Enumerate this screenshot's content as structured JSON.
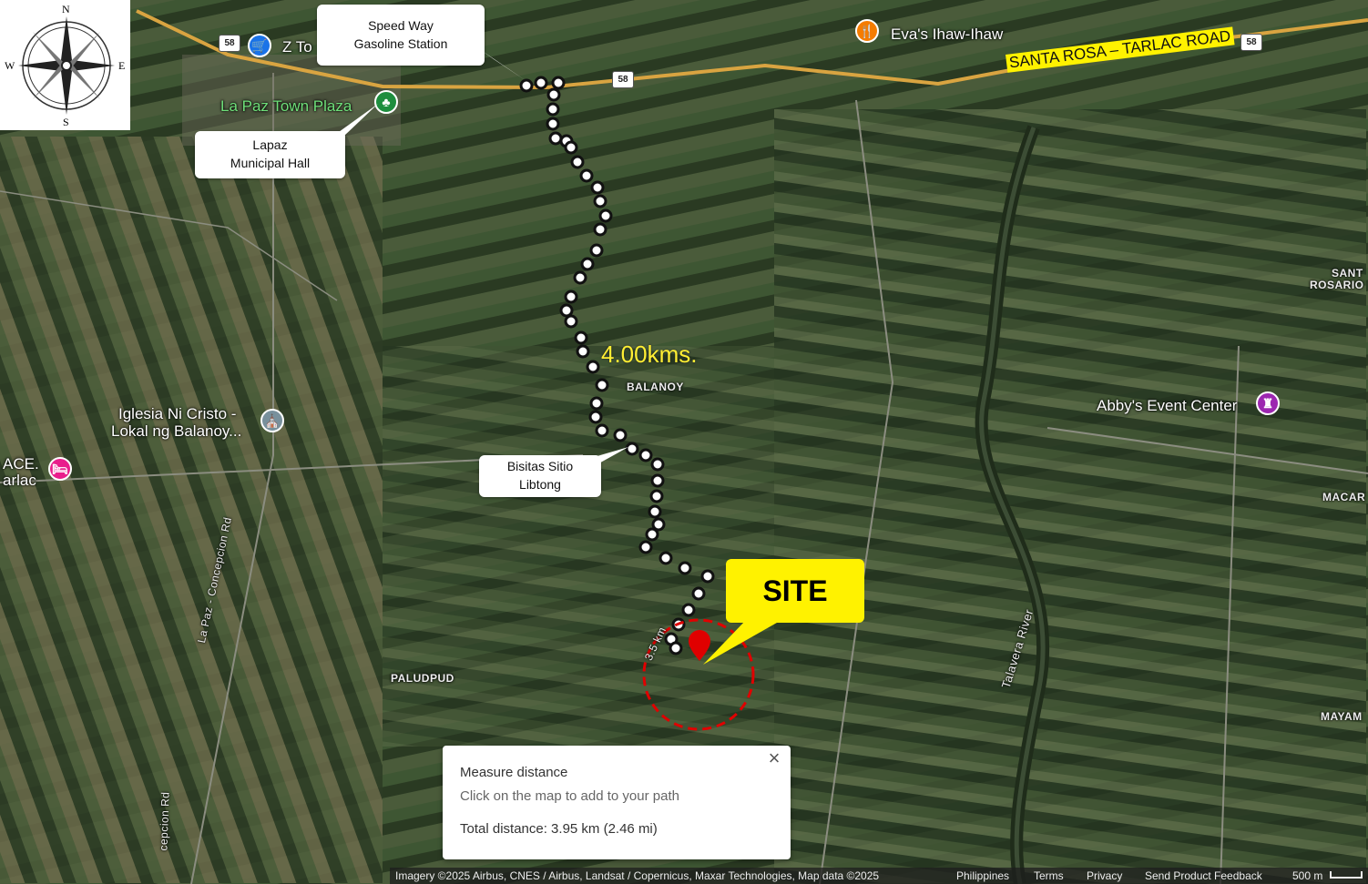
{
  "compass": {
    "n": "N",
    "s": "S",
    "e": "E",
    "w": "W"
  },
  "road_banner": "SANTA ROSA – TARLAC ROAD",
  "route_distance_label": "4.00kms.",
  "site_label": "SITE",
  "places": {
    "evas": "Eva's Ihaw-Ihaw",
    "z_to": "Z To",
    "la_paz_plaza": "La Paz Town Plaza",
    "balanoy": "BALANOY",
    "paludpud": "PALUDPUD",
    "iglesia_line1": "Iglesia Ni Cristo -",
    "iglesia_line2": "Lokal ng Balanoy...",
    "ace_line1": "ACE.",
    "ace_line2": "arlac",
    "abbys": "Abby's Event Center",
    "santa_rosario_1": "SANT",
    "santa_rosario_2": "ROSARIO",
    "macar": "MACAR",
    "mayam": "MAYAM",
    "concepcion_rd": "La Paz - Concepcion Rd",
    "concepcion_rd2": "cepcion Rd",
    "talavera_river": "Talavera River",
    "km_marker": "3.5 km"
  },
  "route_shields": [
    "58",
    "58",
    "58"
  ],
  "callouts": {
    "speedway": [
      "Speed Way",
      "Gasoline Station"
    ],
    "lapaz_hall": [
      "Lapaz",
      "Municipal Hall"
    ],
    "bisitas": [
      "Bisitas Sitio",
      "Libtong"
    ]
  },
  "measure_panel": {
    "title": "Measure distance",
    "hint": "Click on the map to add to your path",
    "total": "Total distance: 3.95 km (2.46 mi)",
    "close": "×"
  },
  "footer": {
    "imagery": "Imagery ©2025 Airbus, CNES / Airbus, Landsat / Copernicus, Maxar Technologies, Map data ©2025",
    "country": "Philippines",
    "terms": "Terms",
    "privacy": "Privacy",
    "feedback": "Send Product Feedback",
    "scale": "500 m"
  },
  "colors": {
    "highlight_yellow": "#fff200",
    "site_circle": "#e00000",
    "route_label": "#ffee33",
    "food_pin": "#f57c00",
    "shop_pin": "#1a73e8",
    "park_pin": "#1e8e3e",
    "church_pin": "#78909c",
    "hotel_pin": "#e91e8c",
    "event_pin": "#9c27b0"
  }
}
